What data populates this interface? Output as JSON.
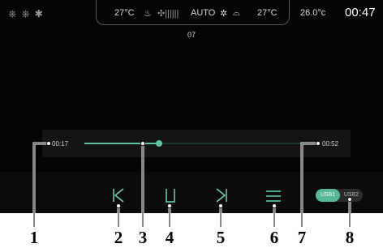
{
  "status": {
    "left_icons": [
      "usb-icon",
      "usb-icon",
      "bluetooth-icon"
    ],
    "climate_left_temp": "27°C",
    "climate_mode": "AUTO",
    "climate_right_temp": "27°C",
    "outside_temp": "26.0°c",
    "clock": "00:47"
  },
  "player": {
    "track_number": "07",
    "elapsed": "00:17",
    "total": "00:52",
    "progress": 0.33
  },
  "controls": {
    "usb1_label": "USB1",
    "usb2_label": "USB2",
    "icons": [
      "previous-icon",
      "pause-icon",
      "next-icon",
      "playlist-icon"
    ]
  },
  "callouts": [
    "1",
    "2",
    "3",
    "4",
    "5",
    "6",
    "7",
    "8"
  ],
  "colors": {
    "accent": "#5cc3a1",
    "background": "#040404"
  }
}
